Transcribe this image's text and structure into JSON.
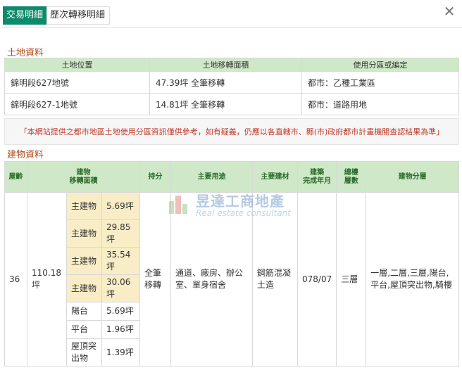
{
  "tabs": [
    {
      "label": "交易明細",
      "active": true
    },
    {
      "label": "歷次轉移明細",
      "active": false
    }
  ],
  "close_label": "✕",
  "land": {
    "section_title": "土地資料",
    "headers": [
      "土地位置",
      "土地移轉面積",
      "使用分區或編定"
    ],
    "rows": [
      [
        "錦明段627地號",
        "47.39坪 全筆移轉",
        "都市：乙種工業區"
      ],
      [
        "錦明段627-1地號",
        "14.81坪 全筆移轉",
        "都市：道路用地"
      ]
    ]
  },
  "notice": "「本網站提供之都市地區土地使用分區資訊僅供參考，如有疑義，仍應以各直轄市、縣(市)政府都市計畫機關查認結果為準」",
  "building": {
    "section_title": "建物資料",
    "headers": {
      "age": "屋齡",
      "area": "建物\n移轉面積",
      "share": "持分",
      "use": "主要用途",
      "material": "主要建材",
      "built": "建築\n完成年月",
      "floors": "總樓\n層數",
      "split": "建物分層"
    },
    "row": {
      "age": "36",
      "area_total": "110.18坪",
      "share": "全筆移轉",
      "use": "通道、廠房、辦公室、單身宿舍",
      "material": "鋼筋混凝土造",
      "built": "078/07",
      "floors": "三層",
      "split": "一層,二層,三層,陽台,平台,屋頂突出物,騎樓"
    },
    "sub_items": [
      {
        "name": "主建物",
        "value": "5.69坪",
        "main": true
      },
      {
        "name": "主建物",
        "value": "29.85坪",
        "main": true
      },
      {
        "name": "主建物",
        "value": "35.54坪",
        "main": true
      },
      {
        "name": "主建物",
        "value": "30.06坪",
        "main": true
      },
      {
        "name": "陽台",
        "value": "5.69坪",
        "main": false
      },
      {
        "name": "平台",
        "value": "1.96坪",
        "main": false
      },
      {
        "name": "屋頂突出物",
        "value": "1.39坪",
        "main": false
      }
    ]
  },
  "watermark": {
    "zh": "昱達工商地產",
    "en": "Real estate consultant"
  },
  "colors": {
    "accent": "#0d8a6a",
    "header_bg": "#cfe9c8",
    "section_title": "#b04a1c",
    "notice": "#c0392b",
    "main_row_bg": "#f8edc6"
  }
}
